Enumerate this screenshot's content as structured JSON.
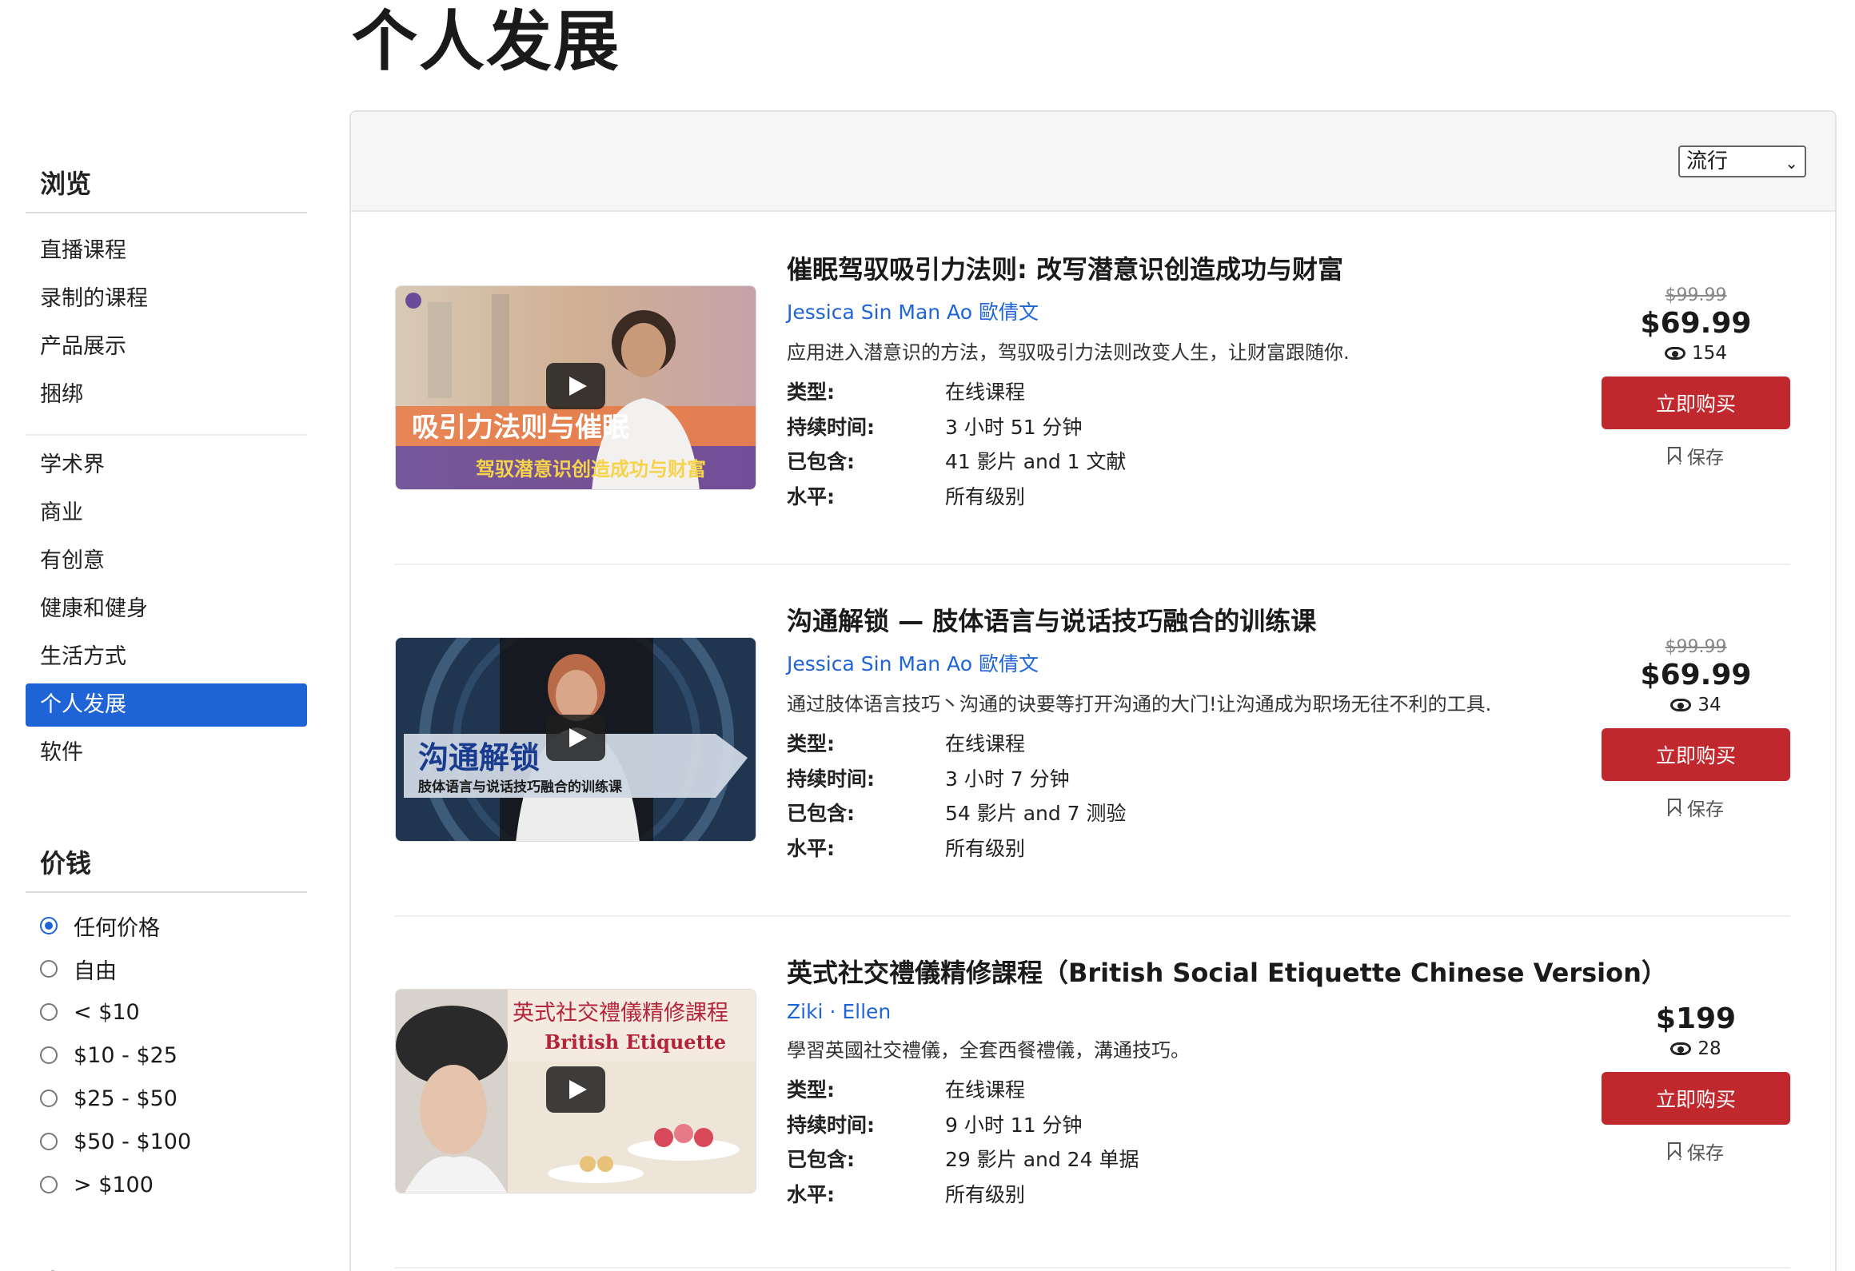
{
  "page": {
    "title": "个人发展"
  },
  "sidebar": {
    "browse_heading": "浏览",
    "browse_items": [
      "直播课程",
      "录制的课程",
      "产品展示",
      "捆绑"
    ],
    "category_items": [
      "学术界",
      "商业",
      "有创意",
      "健康和健身",
      "生活方式",
      "个人发展",
      "软件"
    ],
    "active_category": "个人发展",
    "price_heading": "价钱",
    "price_options": [
      "任何价格",
      "自由",
      "< $10",
      "$10 - $25",
      "$25 - $50",
      "$50 - $100",
      "> $100"
    ],
    "price_selected": "任何价格",
    "level_heading": "水平"
  },
  "sort": {
    "selected": "流行"
  },
  "labels": {
    "type": "类型:",
    "duration": "持续时间:",
    "included": "已包含:",
    "level": "水平:",
    "buy": "立即购买",
    "save": "保存"
  },
  "courses": [
    {
      "title": "催眠驾驭吸引力法则: 改写潜意识创造成功与财富",
      "author": "Jessica Sin Man Ao 歐倩文",
      "description": "应用进入潜意识的方法，驾驭吸引力法则改变人生，让财富跟随你.",
      "type": "在线课程",
      "duration": "3 小时 51 分钟",
      "included": "41 影片 and 1 文献",
      "level": "所有级别",
      "old_price": "$99.99",
      "price": "$69.99",
      "views": "154",
      "thumb_text_1": "吸引力法则与催眠",
      "thumb_text_2": "驾驭潜意识创造成功与财富"
    },
    {
      "title": "沟通解锁 — 肢体语言与说话技巧融合的训练课",
      "author": "Jessica Sin Man Ao 歐倩文",
      "description": "通过肢体语言技巧丶沟通的诀要等打开沟通的大门!让沟通成为职场无往不利的工具.",
      "type": "在线课程",
      "duration": "3 小时 7 分钟",
      "included": "54 影片 and 7 测验",
      "level": "所有级别",
      "old_price": "$99.99",
      "price": "$69.99",
      "views": "34",
      "thumb_text_1": "沟通解锁",
      "thumb_text_2": "肢体语言与说话技巧融合的训练课"
    },
    {
      "title": "英式社交禮儀精修課程（British Social Etiquette Chinese Version）",
      "author": "Ziki · Ellen",
      "description": "學習英國社交禮儀，全套西餐禮儀，溝通技巧。",
      "type": "在线课程",
      "duration": "9 小时 11 分钟",
      "included": "29 影片 and 24 单据",
      "level": "所有级别",
      "old_price": "",
      "price": "$199",
      "views": "28",
      "thumb_text_1": "英式社交禮儀精修課程",
      "thumb_text_2": "British Etiquette"
    }
  ]
}
